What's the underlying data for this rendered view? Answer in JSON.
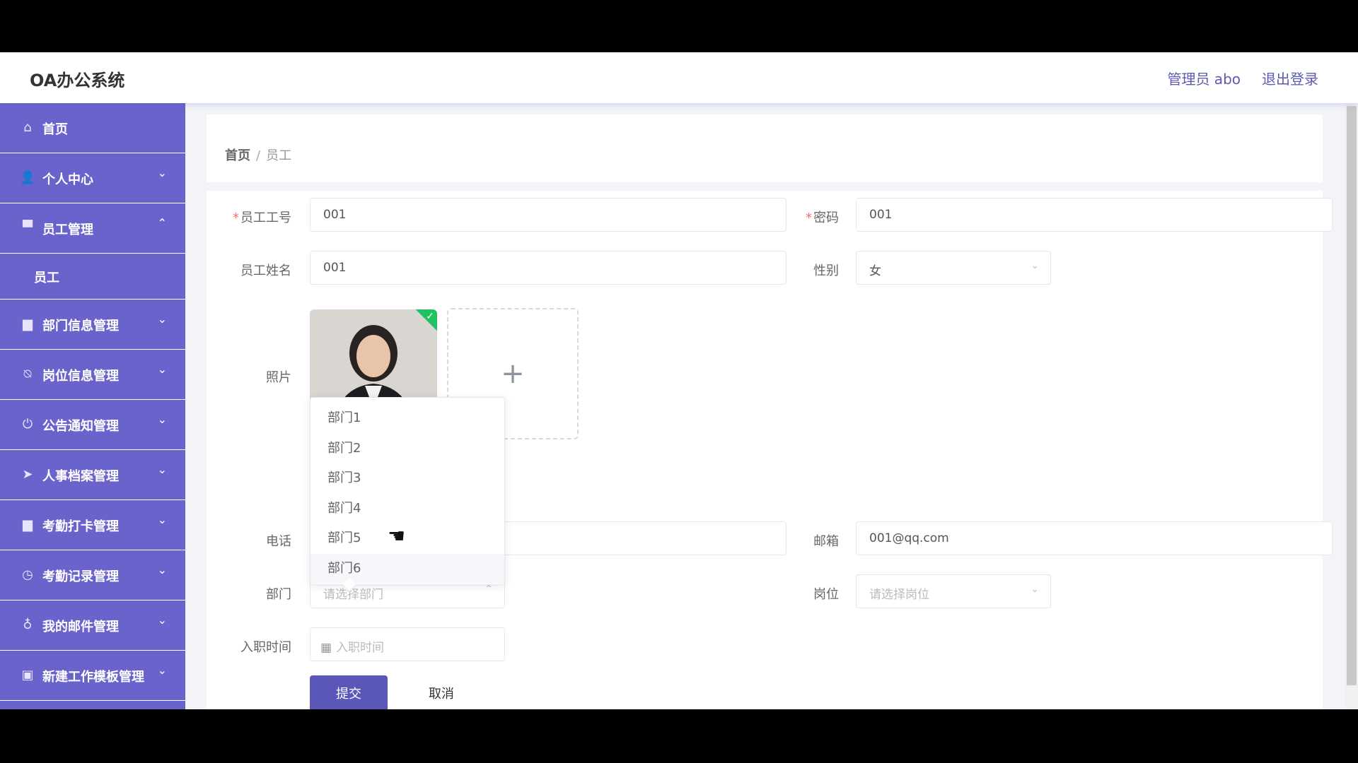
{
  "header": {
    "app_title": "OA办公系统",
    "user_name": "管理员 abo",
    "logout_label": "退出登录"
  },
  "sidebar": {
    "items": [
      {
        "label": "首页",
        "icon": "home-icon",
        "glyph": "⌂",
        "arrow": ""
      },
      {
        "label": "个人中心",
        "icon": "user-icon",
        "glyph": "👤",
        "arrow": "⌄"
      },
      {
        "label": "员工管理",
        "icon": "employee-icon",
        "glyph": "▀",
        "arrow": "⌃"
      },
      {
        "label": "部门信息管理",
        "icon": "monitor-icon",
        "glyph": "▆",
        "arrow": "⌄"
      },
      {
        "label": "岗位信息管理",
        "icon": "bell-off-icon",
        "glyph": "⍉",
        "arrow": "⌄"
      },
      {
        "label": "公告通知管理",
        "icon": "power-icon",
        "glyph": "⏻",
        "arrow": "⌄"
      },
      {
        "label": "人事档案管理",
        "icon": "send-icon",
        "glyph": "➤",
        "arrow": "⌄"
      },
      {
        "label": "考勤打卡管理",
        "icon": "monitor-icon",
        "glyph": "▆",
        "arrow": "⌄"
      },
      {
        "label": "考勤记录管理",
        "icon": "clock-icon",
        "glyph": "◷",
        "arrow": "⌄"
      },
      {
        "label": "我的邮件管理",
        "icon": "microphone-icon",
        "glyph": "♁",
        "arrow": "⌄"
      },
      {
        "label": "新建工作模板管理",
        "icon": "clipboard-icon",
        "glyph": "▣",
        "arrow": "⌄"
      }
    ],
    "submenu_label": "员工"
  },
  "breadcrumb": {
    "home": "首页",
    "separator": "/",
    "current": "员工"
  },
  "form": {
    "employee_no": {
      "label": "员工工号",
      "value": "001"
    },
    "password": {
      "label": "密码",
      "value": "001"
    },
    "employee_name": {
      "label": "员工姓名",
      "value": "001"
    },
    "gender": {
      "label": "性别",
      "value": "女"
    },
    "photo": {
      "label": "照片"
    },
    "phone": {
      "label": "电话",
      "value": ""
    },
    "email": {
      "label": "邮箱",
      "value": "001@qq.com"
    },
    "department": {
      "label": "部门",
      "placeholder": "请选择部门"
    },
    "position": {
      "label": "岗位",
      "placeholder": "请选择岗位"
    },
    "hire_date": {
      "label": "入职时间",
      "placeholder": "入职时间"
    },
    "submit_label": "提交",
    "cancel_label": "取消"
  },
  "department_dropdown": {
    "options": [
      "部门1",
      "部门2",
      "部门3",
      "部门4",
      "部门5",
      "部门6"
    ],
    "hovered": "部门6"
  },
  "colors": {
    "sidebar": "#6a63cc",
    "accent": "#5b57b8",
    "required": "#f56c6c",
    "upload_success": "#20c25f"
  }
}
